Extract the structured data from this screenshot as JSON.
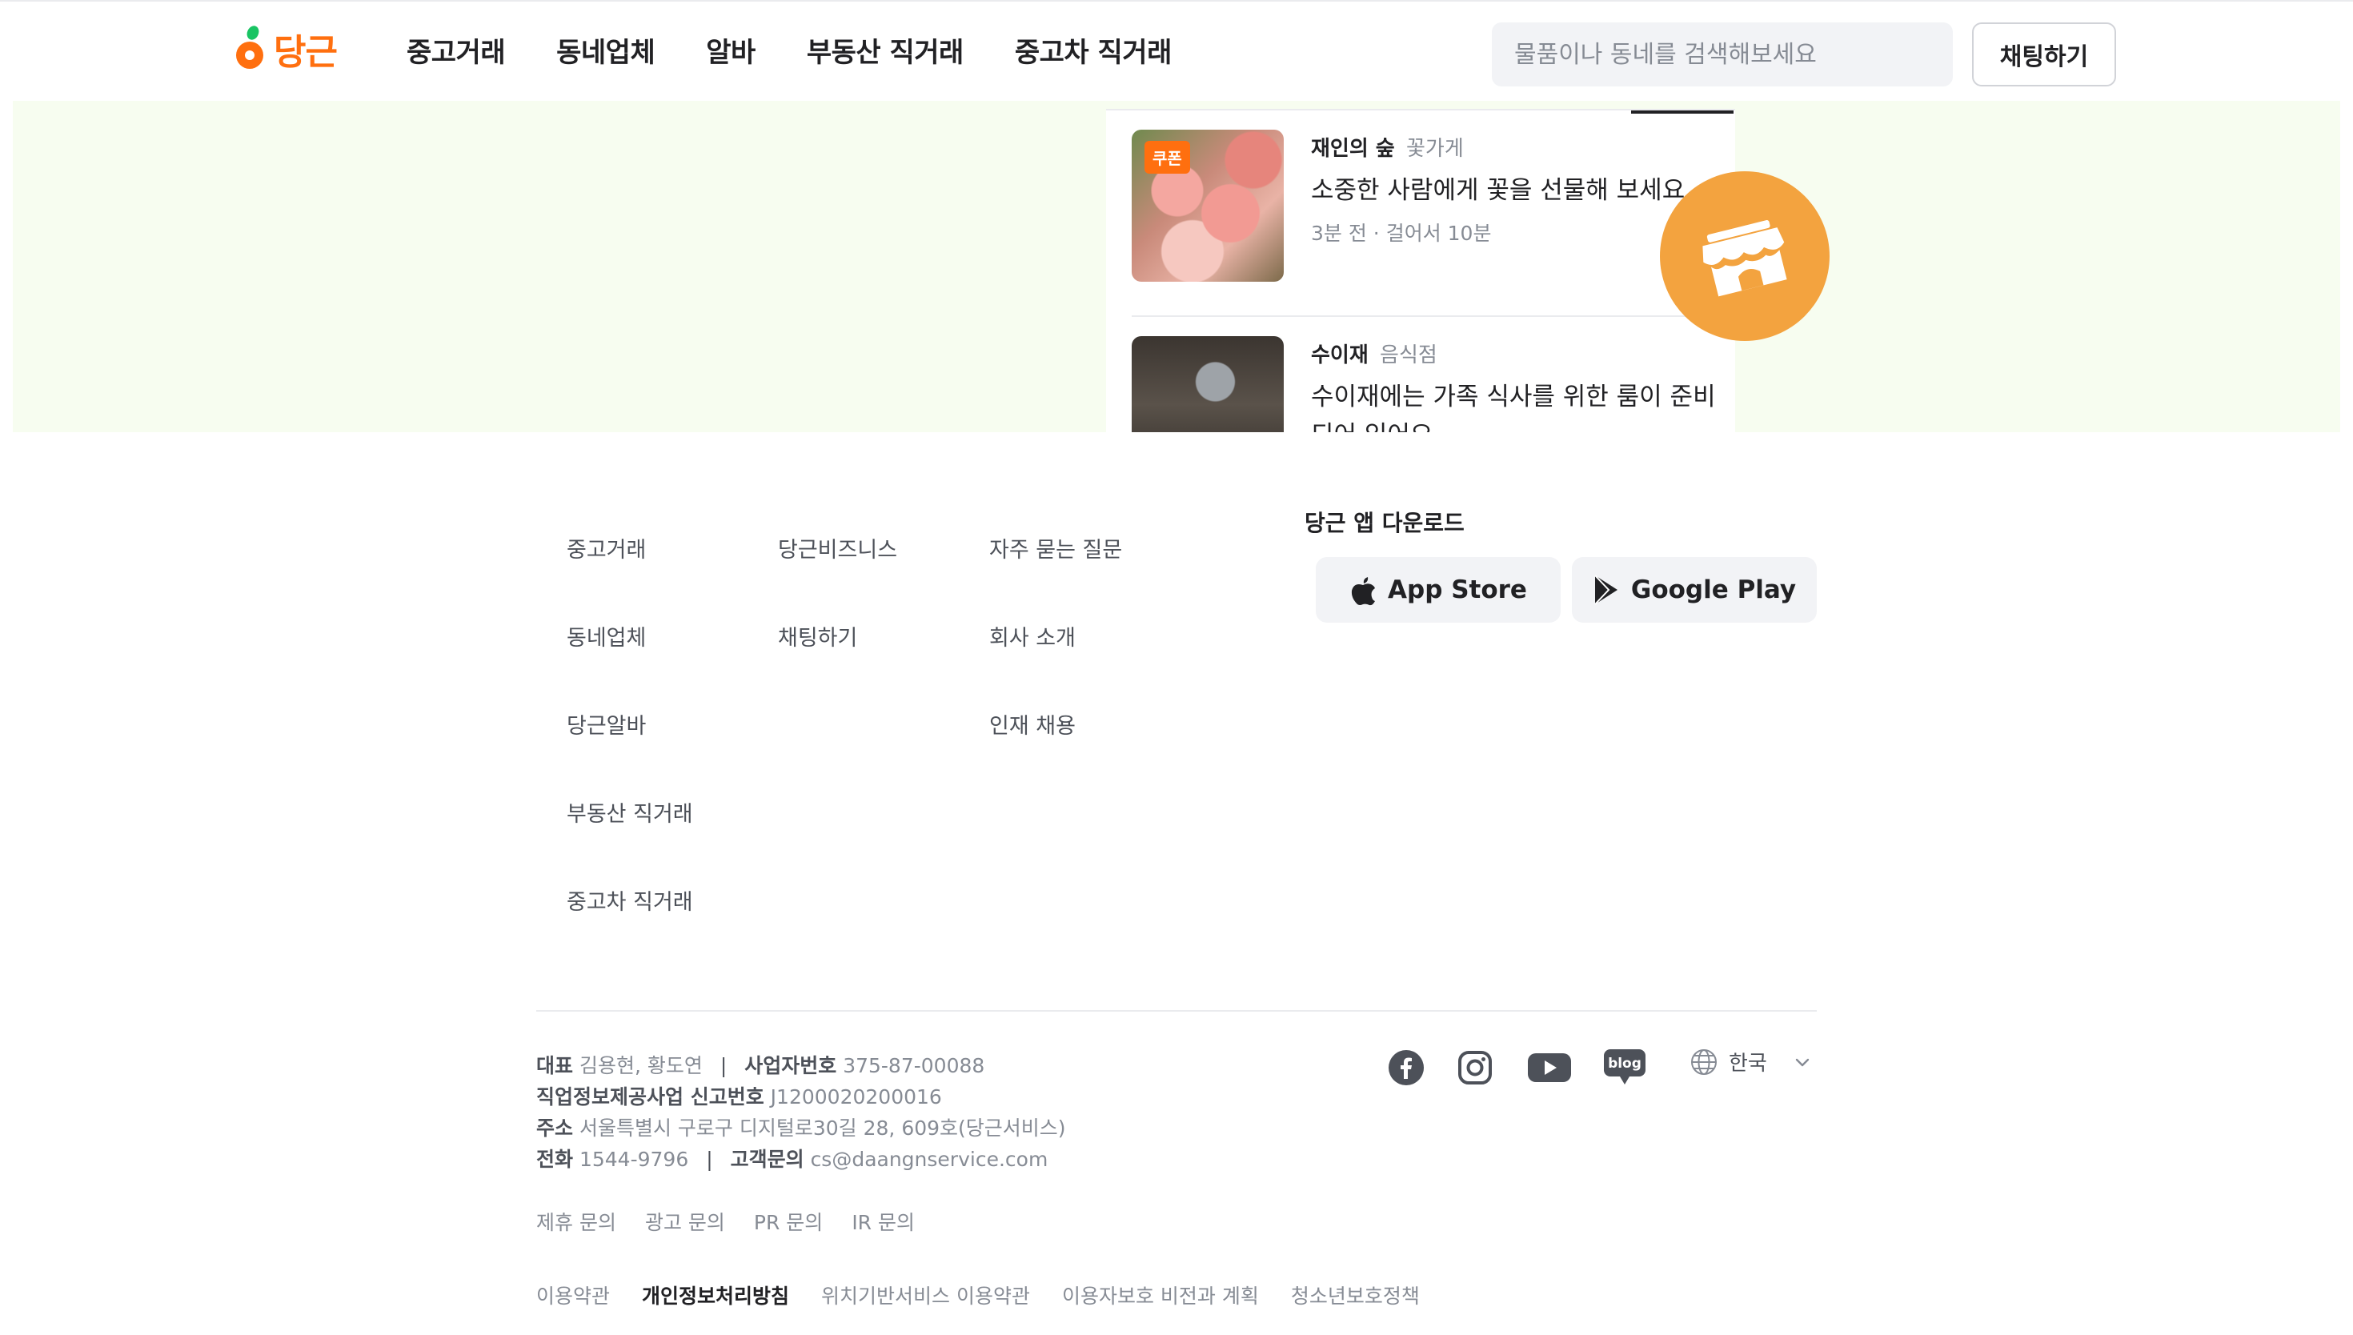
{
  "header": {
    "logo_text": "당근",
    "nav": [
      "중고거래",
      "동네업체",
      "알바",
      "부동산 직거래",
      "중고차 직거래"
    ],
    "search_placeholder": "물품이나 동네를 검색해보세요",
    "chat_button": "채팅하기"
  },
  "stores": [
    {
      "name": "재인의 숲",
      "category": "꽃가게",
      "description": "소중한 사람에게 꽃을 선물해 보세요.",
      "meta": "3분 전 · 걸어서 10분",
      "coupon_label": "쿠폰"
    },
    {
      "name": "수이재",
      "category": "음식점",
      "description": "수이재에는 가족 식사를 위한 룸이 준비되어 있어요."
    }
  ],
  "footer": {
    "columns": [
      [
        "중고거래",
        "동네업체",
        "당근알바",
        "부동산 직거래",
        "중고차 직거래"
      ],
      [
        "당근비즈니스",
        "채팅하기"
      ],
      [
        "자주 묻는 질문",
        "회사 소개",
        "인재 채용"
      ]
    ],
    "download_title": "당근 앱 다운로드",
    "app_store": "App Store",
    "google_play": "Google Play",
    "company": {
      "ceo_label": "대표",
      "ceo": "김용현, 황도연",
      "biz_no_label": "사업자번호",
      "biz_no": "375-87-00088",
      "job_info_label": "직업정보제공사업 신고번호",
      "job_info": "J1200020200016",
      "address_label": "주소",
      "address": "서울특별시 구로구 디지털로30길 28, 609호(당근서비스)",
      "phone_label": "전화",
      "phone": "1544-9796",
      "cs_label": "고객문의",
      "cs_email": "cs@daangnservice.com"
    },
    "inquiries": [
      "제휴 문의",
      "광고 문의",
      "PR 문의",
      "IR 문의"
    ],
    "policies": [
      "이용약관",
      "개인정보처리방침",
      "위치기반서비스 이용약관",
      "이용자보호 비전과 계획",
      "청소년보호정책"
    ],
    "language": "한국",
    "blog_label": "blog"
  },
  "colors": {
    "brand": "#ff6f0f",
    "hero_bg": "#f7fdf0",
    "badge": "#f3a33f"
  }
}
